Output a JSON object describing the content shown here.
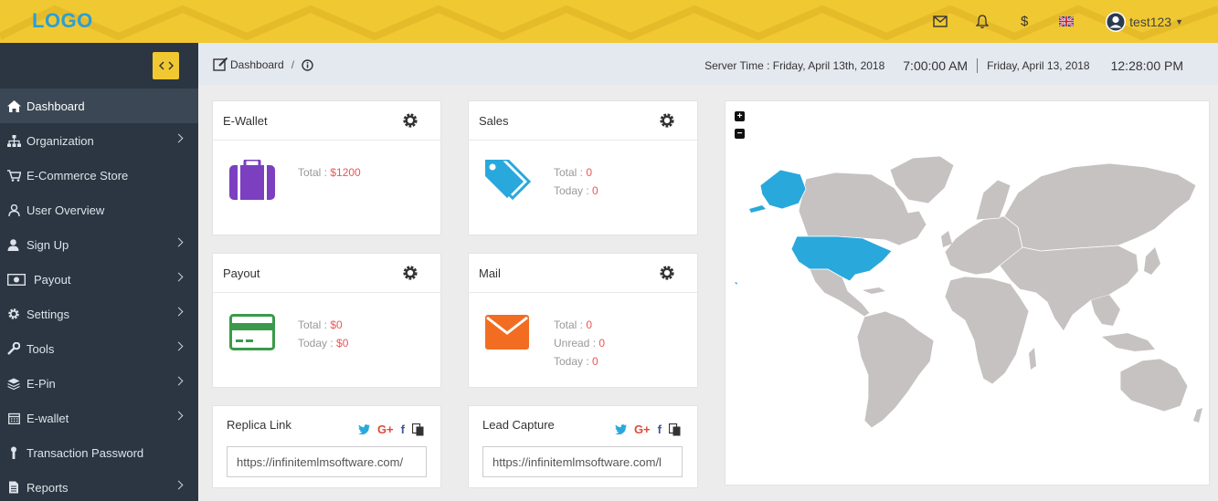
{
  "header": {
    "logo": "LOGO",
    "icons": [
      "envelope-icon",
      "bell-icon",
      "dollar-icon",
      "uk-flag-icon"
    ],
    "currency_symbol": "$",
    "username": "test123"
  },
  "sidebar": {
    "items": [
      {
        "label": "Dashboard",
        "icon": "home-icon",
        "has_submenu": false,
        "active": true
      },
      {
        "label": "Organization",
        "icon": "sitemap-icon",
        "has_submenu": true
      },
      {
        "label": "E-Commerce Store",
        "icon": "cart-icon",
        "has_submenu": false
      },
      {
        "label": "User Overview",
        "icon": "user-icon",
        "has_submenu": false
      },
      {
        "label": "Sign Up",
        "icon": "user-plus-icon",
        "has_submenu": true
      },
      {
        "label": "Payout",
        "icon": "money-icon",
        "has_submenu": true
      },
      {
        "label": "Settings",
        "icon": "gear-icon",
        "has_submenu": true
      },
      {
        "label": "Tools",
        "icon": "wrench-icon",
        "has_submenu": true
      },
      {
        "label": "E-Pin",
        "icon": "layers-icon",
        "has_submenu": true
      },
      {
        "label": "E-wallet",
        "icon": "calendar-icon",
        "has_submenu": true
      },
      {
        "label": "Transaction Password",
        "icon": "key-icon",
        "has_submenu": false
      },
      {
        "label": "Reports",
        "icon": "file-icon",
        "has_submenu": true
      }
    ]
  },
  "breadcrumb": {
    "page": "Dashboard",
    "separator": "/",
    "server_time_label": "Server Time : Friday, April 13th, 2018",
    "server_time": "7:00:00 AM",
    "local_date": "Friday, April 13, 2018",
    "local_time": "12:28:00 PM"
  },
  "cards": {
    "ewallet": {
      "title": "E-Wallet",
      "total_label": "Total : ",
      "total": "$1200",
      "icon_color": "#7b3fbf"
    },
    "sales": {
      "title": "Sales",
      "total_label": "Total : ",
      "total": "0",
      "today_label": "Today : ",
      "today": "0",
      "icon_color": "#29a8dc"
    },
    "payout": {
      "title": "Payout",
      "total_label": "Total : ",
      "total": "$0",
      "today_label": "Today : ",
      "today": "$0",
      "icon_color": "#3a9a4a"
    },
    "mail": {
      "title": "Mail",
      "total_label": "Total : ",
      "total": "0",
      "unread_label": "Unread : ",
      "unread": "0",
      "today_label": "Today : ",
      "today": "0",
      "icon_color": "#f26d21"
    }
  },
  "replica": {
    "title": "Replica Link",
    "url": "https://infinitemlmsoftware.com/"
  },
  "lead": {
    "title": "Lead Capture",
    "url": "https://infinitemlmsoftware.com/l"
  },
  "share": {
    "twitter": "twitter-icon",
    "google": "G+",
    "facebook": "f",
    "copy": "copy-icon"
  },
  "map": {
    "zoom_in": "+",
    "zoom_out": "−",
    "highlight_color": "#29a8dc",
    "land_color": "#c7c2c2"
  }
}
